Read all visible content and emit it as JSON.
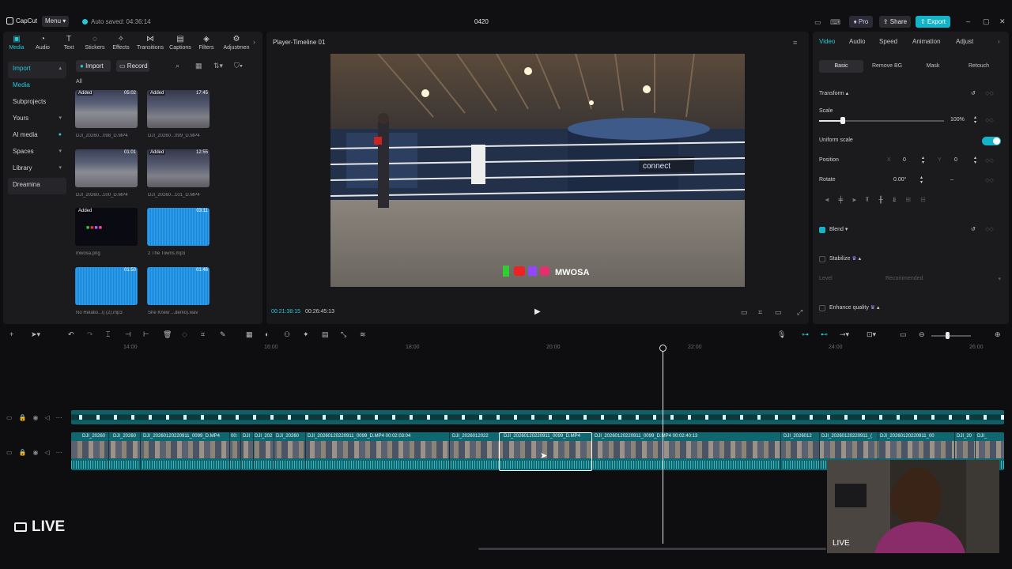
{
  "app": {
    "name": "CapCut",
    "menu_label": "Menu",
    "autosave": "Auto saved: 04:36:14",
    "project_title": "0420"
  },
  "header": {
    "pro_label": "Pro",
    "share_label": "Share",
    "export_label": "Export"
  },
  "toolbar": {
    "items": [
      {
        "label": "Media",
        "icon": "media-icon",
        "active": true
      },
      {
        "label": "Audio",
        "icon": "audio-icon"
      },
      {
        "label": "Text",
        "icon": "text-icon"
      },
      {
        "label": "Stickers",
        "icon": "stickers-icon"
      },
      {
        "label": "Effects",
        "icon": "effects-icon"
      },
      {
        "label": "Transitions",
        "icon": "transitions-icon"
      },
      {
        "label": "Captions",
        "icon": "captions-icon"
      },
      {
        "label": "Filters",
        "icon": "filters-icon"
      },
      {
        "label": "Adjustmen",
        "icon": "adjustment-icon"
      }
    ]
  },
  "sidenav": {
    "items": [
      {
        "label": "Import"
      },
      {
        "label": "Media"
      },
      {
        "label": "Subprojects"
      },
      {
        "label": "Yours"
      },
      {
        "label": "AI media"
      },
      {
        "label": "Spaces"
      },
      {
        "label": "Library"
      },
      {
        "label": "Dreamina"
      }
    ]
  },
  "media": {
    "import_label": "Import",
    "record_label": "Record",
    "filter_label": "All",
    "items": [
      {
        "caption": "DJI_20260...098_D.MP4",
        "badge": "Added",
        "duration": "05:02",
        "kind": "video"
      },
      {
        "caption": "DJI_20260...099_D.MP4",
        "badge": "Added",
        "duration": "17:45",
        "kind": "video"
      },
      {
        "caption": "DJI_20260...100_D.MP4",
        "badge": "",
        "duration": "01:01",
        "kind": "video"
      },
      {
        "caption": "DJI_20260...101_D.MP4",
        "badge": "Added",
        "duration": "12:55",
        "kind": "video"
      },
      {
        "caption": "mwosa.png",
        "badge": "Added",
        "duration": "",
        "kind": "image"
      },
      {
        "caption": "2 The Towns.mp3",
        "badge": "",
        "duration": "03:11",
        "kind": "audio"
      },
      {
        "caption": "No Relatio...l) (2).mp3",
        "badge": "",
        "duration": "01:50",
        "kind": "audio"
      },
      {
        "caption": "She Knew ...demo).wav",
        "badge": "",
        "duration": "01:46",
        "kind": "audio"
      }
    ]
  },
  "player": {
    "title": "Player-Timeline 01",
    "current_time": "00:21:38:15",
    "total_time": "00:26:45:13",
    "overlay_text": "MWOSA"
  },
  "inspector": {
    "tabs": [
      "Video",
      "Audio",
      "Speed",
      "Animation",
      "Adjust"
    ],
    "subtabs": [
      "Basic",
      "Remove BG",
      "Mask",
      "Retouch"
    ],
    "transform_label": "Transform",
    "scale_label": "Scale",
    "scale_value": "100%",
    "scale_fraction": 0.19,
    "uniform_scale_label": "Uniform scale",
    "position_label": "Position",
    "pos_x_label": "X",
    "pos_x": "0",
    "pos_y_label": "Y",
    "pos_y": "0",
    "rotate_label": "Rotate",
    "rotate_value": "0.00°",
    "rotate_dash": "–",
    "blend_label": "Blend",
    "stabilize_label": "Stabilize",
    "stabilize_level_label": "Level",
    "stabilize_level_value": "Recommended",
    "enhance_label": "Enhance quality"
  },
  "timeline": {
    "ruler": [
      "14:00",
      "16:00",
      "18:00",
      "20:00",
      "22:00",
      "24:00",
      "26:00"
    ],
    "clips": [
      {
        "label": "DJI_20260"
      },
      {
        "label": "DJI_20260"
      },
      {
        "label": "DJI_20260120220911_0099_D.MP4"
      },
      {
        "label": "00:"
      },
      {
        "label": "DJI"
      },
      {
        "label": "DJI_202"
      },
      {
        "label": "DJI_20260"
      },
      {
        "label": "DJI_20260120220911_0099_D.MP4   00:02:03:04"
      },
      {
        "label": "DJI_2026012022"
      },
      {
        "label": "DJI_20260120220911_0099_D.MP4"
      },
      {
        "label": "DJI_20260120220911_0099_D.MP4   00:02:40:13"
      },
      {
        "label": "DJI_2026012"
      },
      {
        "label": "DJI_20260120220911_("
      },
      {
        "label": "DJI_20260120220911_00"
      },
      {
        "label": "DJI_20"
      },
      {
        "label": "DJI_"
      }
    ]
  },
  "stream": {
    "live_label": "LIVE",
    "webcam_live_label": "LIVE"
  },
  "colors": {
    "accent": "#13b4c8",
    "track": "#0f6870"
  }
}
